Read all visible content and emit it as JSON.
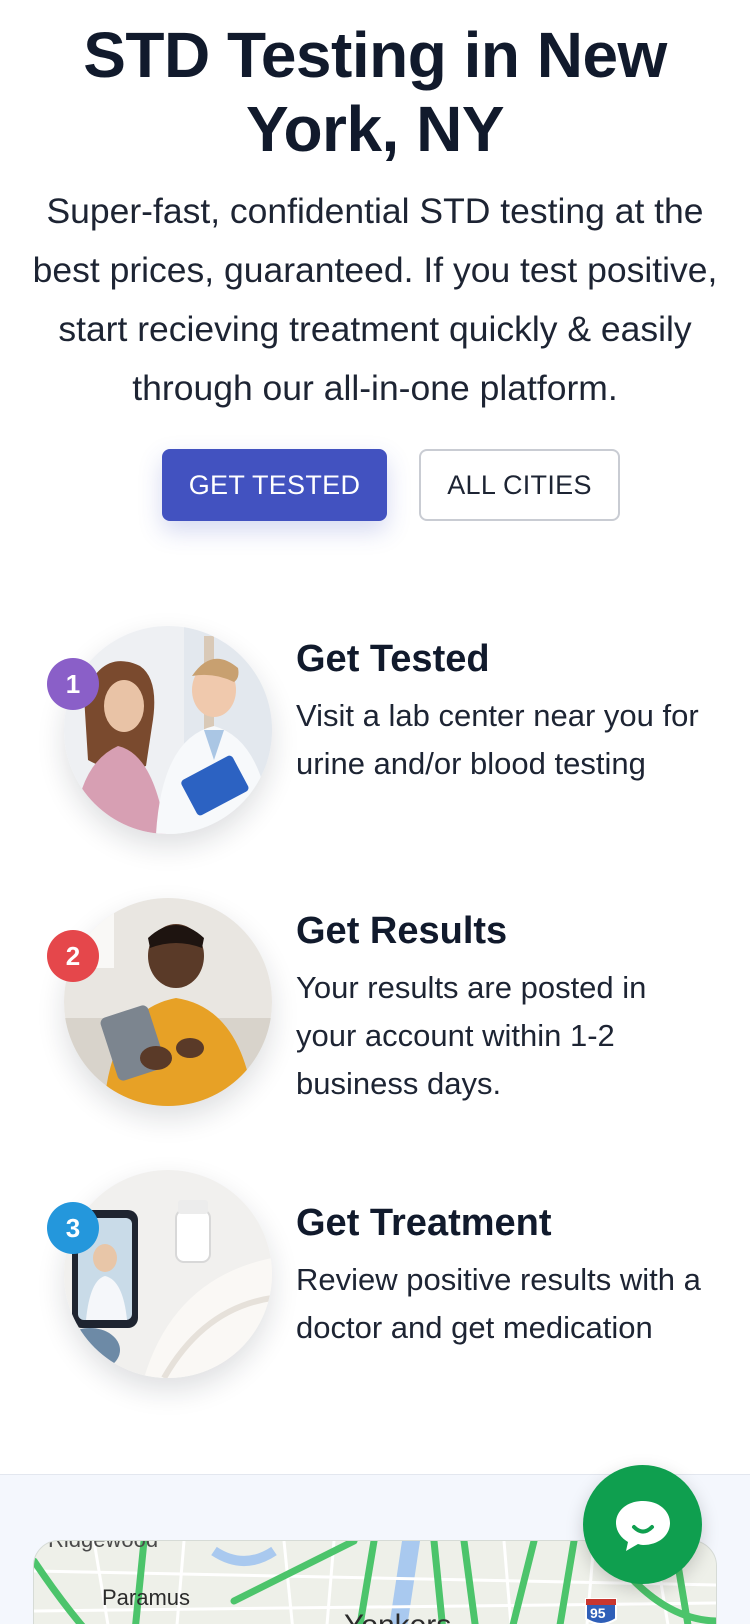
{
  "hero": {
    "title": "STD Testing in New York, NY",
    "subtitle": "Super-fast, confidential STD testing at the best prices, guaranteed. If you test positive, start recieving treatment quickly & easily through our all-in-one platform.",
    "primary_button": "GET TESTED",
    "secondary_button": "ALL CITIES"
  },
  "steps": [
    {
      "number": "1",
      "title": "Get Tested",
      "description": "Visit a lab center near you for urine and/or blood testing",
      "badge_color": "#8a5fc8"
    },
    {
      "number": "2",
      "title": "Get Results",
      "description": "Your results are posted in your account within 1-2 business days.",
      "badge_color": "#e5474b"
    },
    {
      "number": "3",
      "title": "Get Treatment",
      "description": "Review positive results with a doctor and get medication",
      "badge_color": "#2497dc"
    }
  ],
  "map": {
    "labels": [
      "Ridgewood",
      "Paramus",
      "Yonkers"
    ],
    "highway_shield": "95"
  },
  "chat": {
    "icon": "chat-bubble-icon"
  },
  "colors": {
    "primary": "#4252c0",
    "chat": "#0f9f4f",
    "heading": "#111a2c"
  }
}
